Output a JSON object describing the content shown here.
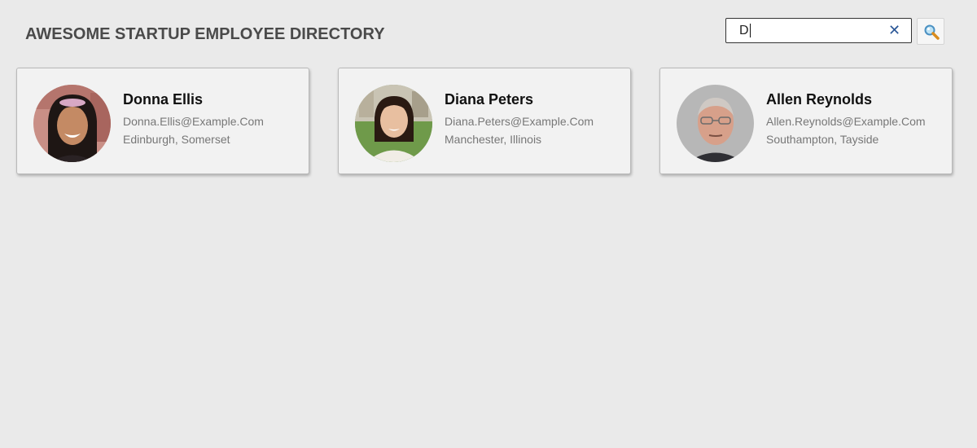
{
  "header": {
    "title": "AWESOME STARTUP EMPLOYEE DIRECTORY"
  },
  "search": {
    "value": "D",
    "clear_icon": "close-icon",
    "button_icon": "magnifier-icon"
  },
  "colors": {
    "background": "#eaeaea",
    "card_background": "#f2f2f2",
    "clear_icon": "#2b5797"
  },
  "employees": [
    {
      "name": "Donna Ellis",
      "email": "Donna.Ellis@Example.Com",
      "location": "Edinburgh, Somerset"
    },
    {
      "name": "Diana Peters",
      "email": "Diana.Peters@Example.Com",
      "location": "Manchester, Illinois"
    },
    {
      "name": "Allen Reynolds",
      "email": "Allen.Reynolds@Example.Com",
      "location": "Southampton, Tayside"
    }
  ]
}
